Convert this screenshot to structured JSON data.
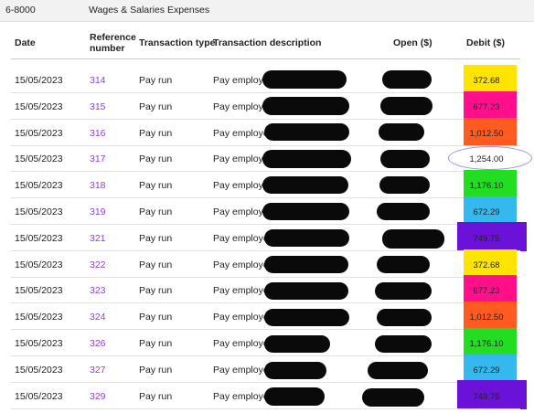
{
  "account": {
    "code": "6-8000",
    "name": "Wages & Salaries Expenses"
  },
  "columns": {
    "date": "Date",
    "reference_line1": "Reference",
    "reference_line2": "number",
    "type": "Transaction type",
    "description": "Transaction description",
    "open": "Open ($)",
    "debit": "Debit ($)"
  },
  "rows": [
    {
      "date": "15/05/2023",
      "ref": "314",
      "type": "Pay run",
      "desc": "Pay employee",
      "debit": "372.68",
      "highlight": "#ffe400"
    },
    {
      "date": "15/05/2023",
      "ref": "315",
      "type": "Pay run",
      "desc": "Pay employee",
      "debit": "677.23",
      "highlight": "#ff0f8c"
    },
    {
      "date": "15/05/2023",
      "ref": "316",
      "type": "Pay run",
      "desc": "Pay employee;",
      "debit": "1,012.50",
      "highlight": "#ff5a1f"
    },
    {
      "date": "15/05/2023",
      "ref": "317",
      "type": "Pay run",
      "desc": "Pay employe",
      "debit": "1,254.00",
      "highlight": "none"
    },
    {
      "date": "15/05/2023",
      "ref": "318",
      "type": "Pay run",
      "desc": "Pay employee",
      "debit": "1,176.10",
      "highlight": "#22dd22"
    },
    {
      "date": "15/05/2023",
      "ref": "319",
      "type": "Pay run",
      "desc": "Pay employee",
      "debit": "672.29",
      "highlight": "#35b8ee"
    },
    {
      "date": "15/05/2023",
      "ref": "321",
      "type": "Pay run",
      "desc": "Pay employee;",
      "debit": "749.75",
      "highlight": "#6a12d8"
    },
    {
      "date": "15/05/2023",
      "ref": "322",
      "type": "Pay run",
      "desc": "Pay employee",
      "debit": "372.68",
      "highlight": "#ffe400"
    },
    {
      "date": "15/05/2023",
      "ref": "323",
      "type": "Pay run",
      "desc": "Pay employee",
      "debit": "677.23",
      "highlight": "#ff0f8c"
    },
    {
      "date": "15/05/2023",
      "ref": "324",
      "type": "Pay run",
      "desc": "Pay employee",
      "debit": "1,012.50",
      "highlight": "#ff5a1f"
    },
    {
      "date": "15/05/2023",
      "ref": "326",
      "type": "Pay run",
      "desc": "Pay employee;",
      "debit": "1,176.10",
      "highlight": "#22dd22"
    },
    {
      "date": "15/05/2023",
      "ref": "327",
      "type": "Pay run",
      "desc": "Pay employee;",
      "debit": "672.29",
      "highlight": "#35b8ee"
    },
    {
      "date": "15/05/2023",
      "ref": "329",
      "type": "Pay run",
      "desc": "Pay employee;",
      "debit": "749.75",
      "highlight": "#6a12d8"
    }
  ]
}
